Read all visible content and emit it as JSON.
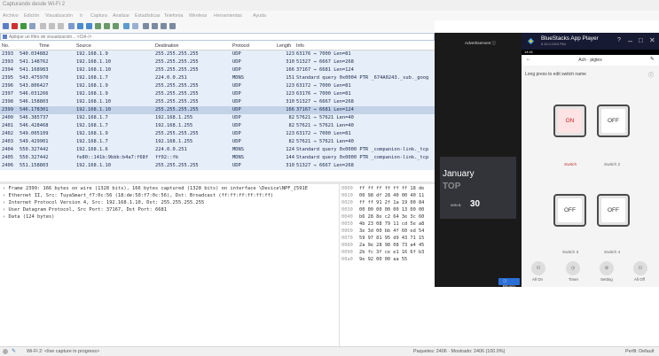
{
  "wireshark": {
    "title": "Capturando desde Wi-Fi 2",
    "menu": [
      "Archivo",
      "Edición",
      "Visualización",
      "Ir",
      "Captura",
      "Analizar",
      "Estadísticas",
      "Telefonía",
      "Wireless",
      "Herramientas",
      "Ayuda"
    ],
    "filter_placeholder": "Aplique un filtro de visualización... <Ctrl-/>",
    "columns": [
      "No.",
      "Time",
      "Source",
      "Destination",
      "Protocol",
      "Length",
      "Info"
    ],
    "packets": [
      {
        "no": "2393",
        "time": "540.034882",
        "src": "192.168.1.9",
        "dst": "255.255.255.255",
        "proto": "UDP",
        "len": "123",
        "info": "63176 → 7000 Len=81"
      },
      {
        "no": "2393",
        "time": "541.148762",
        "src": "192.168.1.10",
        "dst": "255.255.255.255",
        "proto": "UDP",
        "len": "310",
        "info": "51327 → 6667 Len=268"
      },
      {
        "no": "2394",
        "time": "541.168983",
        "src": "192.168.1.10",
        "dst": "255.255.255.255",
        "proto": "UDP",
        "len": "166",
        "info": "37167 → 6681 Len=124"
      },
      {
        "no": "2395",
        "time": "543.475970",
        "src": "192.168.1.7",
        "dst": "224.0.0.251",
        "proto": "MDNS",
        "len": "151",
        "info": "Standard query 0x0004 PTR _674A0243._sub._goog"
      },
      {
        "no": "2396",
        "time": "543.806427",
        "src": "192.168.1.9",
        "dst": "255.255.255.255",
        "proto": "UDP",
        "len": "123",
        "info": "63172 → 7000 Len=81"
      },
      {
        "no": "2397",
        "time": "546.031266",
        "src": "192.168.1.9",
        "dst": "255.255.255.255",
        "proto": "UDP",
        "len": "123",
        "info": "63176 → 7000 Len=81"
      },
      {
        "no": "2398",
        "time": "546.158803",
        "src": "192.168.1.10",
        "dst": "255.255.255.255",
        "proto": "UDP",
        "len": "310",
        "info": "51327 → 6667 Len=268"
      },
      {
        "no": "2399",
        "time": "546.178301",
        "src": "192.168.1.10",
        "dst": "255.255.255.255",
        "proto": "UDP",
        "len": "166",
        "info": "37167 → 6681 Len=124"
      },
      {
        "no": "2400",
        "time": "546.385737",
        "src": "192.168.1.7",
        "dst": "192.168.1.255",
        "proto": "UDP",
        "len": "82",
        "info": "57621 → 57621 Len=40"
      },
      {
        "no": "2401",
        "time": "546.428468",
        "src": "192.168.1.7",
        "dst": "192.168.1.255",
        "proto": "UDP",
        "len": "82",
        "info": "57621 → 57621 Len=40"
      },
      {
        "no": "2402",
        "time": "549.005109",
        "src": "192.168.1.9",
        "dst": "255.255.255.255",
        "proto": "UDP",
        "len": "123",
        "info": "63172 → 7000 Len=81"
      },
      {
        "no": "2403",
        "time": "549.429901",
        "src": "192.168.1.7",
        "dst": "192.168.1.255",
        "proto": "UDP",
        "len": "82",
        "info": "57621 → 57621 Len=40"
      },
      {
        "no": "2404",
        "time": "550.327442",
        "src": "192.168.1.6",
        "dst": "224.0.0.251",
        "proto": "MDNS",
        "len": "124",
        "info": "Standard query 0x0000 PTR _companion-link._tcp"
      },
      {
        "no": "2405",
        "time": "550.327442",
        "src": "fe80::141b:9bbb:b4a7:f68f",
        "dst": "ff02::fb",
        "proto": "MDNS",
        "len": "144",
        "info": "Standard query 0x0000 PTR _companion-link._tcp"
      },
      {
        "no": "2406",
        "time": "551.158803",
        "src": "192.168.1.10",
        "dst": "255.255.255.255",
        "proto": "UDP",
        "len": "310",
        "info": "51327 → 6667 Len=268"
      }
    ],
    "selected_index": 7,
    "details": [
      "Frame 2399: 166 bytes on wire (1328 bits), 166 bytes captured (1328 bits) on interface \\Device\\NPF_{591E",
      "Ethernet II, Src: TuyaSmart_f7:0c:56 (18:de:50:f7:0c:56), Dst: Broadcast (ff:ff:ff:ff:ff:ff)",
      "Internet Protocol Version 4, Src: 192.168.1.10, Dst: 255.255.255.255",
      "User Datagram Protocol, Src Port: 37167, Dst Port: 6681",
      "Data (124 bytes)"
    ],
    "hex": [
      {
        "off": "0000",
        "bytes": "ff ff ff ff ff ff 18 de"
      },
      {
        "off": "0010",
        "bytes": "00 98 df 28 40 00 40 11"
      },
      {
        "off": "0020",
        "bytes": "ff ff 91 2f 1a 19 00 84"
      },
      {
        "off": "0030",
        "bytes": "00 00 00 00 00 13 00 00"
      },
      {
        "off": "0040",
        "bytes": "b6 28 8e c2 64 3e 3c 60"
      },
      {
        "off": "0050",
        "bytes": "4b 23 08 79 11 cd 5e a8"
      },
      {
        "off": "0060",
        "bytes": "3e 3d 00 bb 4f 60 ed 54"
      },
      {
        "off": "0070",
        "bytes": "59 97 81 95 d9 43 71 15"
      },
      {
        "off": "0080",
        "bytes": "2a 9e 28 98 08 73 a4 45"
      },
      {
        "off": "0090",
        "bytes": "2b fc 3f ce e1 16 6f b3"
      },
      {
        "off": "00a0",
        "bytes": "9e 92 00 00 aa 55"
      }
    ],
    "status": {
      "capture": "Wi-Fi 2: <live capture in progress>",
      "packets": "Paquetes: 2406 · Mostrado: 2406 (100.0%)",
      "profile": "Perfil: Default"
    }
  },
  "ad": {
    "label": "Advertisement ⓘ",
    "headline": "January",
    "sub": "TOP",
    "number": "30",
    "logo_text": "WIN\nB",
    "privacy": "ⓘ Privacy"
  },
  "bluestacks": {
    "title": "BlueStacks App Player",
    "version": "5.10.0.1010 P64",
    "time": "14:41",
    "app_title": "Ach · pigtex",
    "hint": "Long press to edit switch name",
    "switches": [
      {
        "state": "ON",
        "label": "Switch"
      },
      {
        "state": "OFF",
        "label": "Switch 2"
      },
      {
        "state": "OFF",
        "label": "Switch 3"
      },
      {
        "state": "OFF",
        "label": "Switch 4"
      }
    ],
    "nav": [
      "All On",
      "Timer",
      "Setting",
      "All Off"
    ],
    "nav_icons": [
      "⏻",
      "◷",
      "⚙",
      "⏻"
    ]
  },
  "colors": {
    "selected_row": "#c4d2e8",
    "udp_row": "#e6eef9",
    "bs_titlebar": "#161a33",
    "switch_on": "#d02020"
  }
}
